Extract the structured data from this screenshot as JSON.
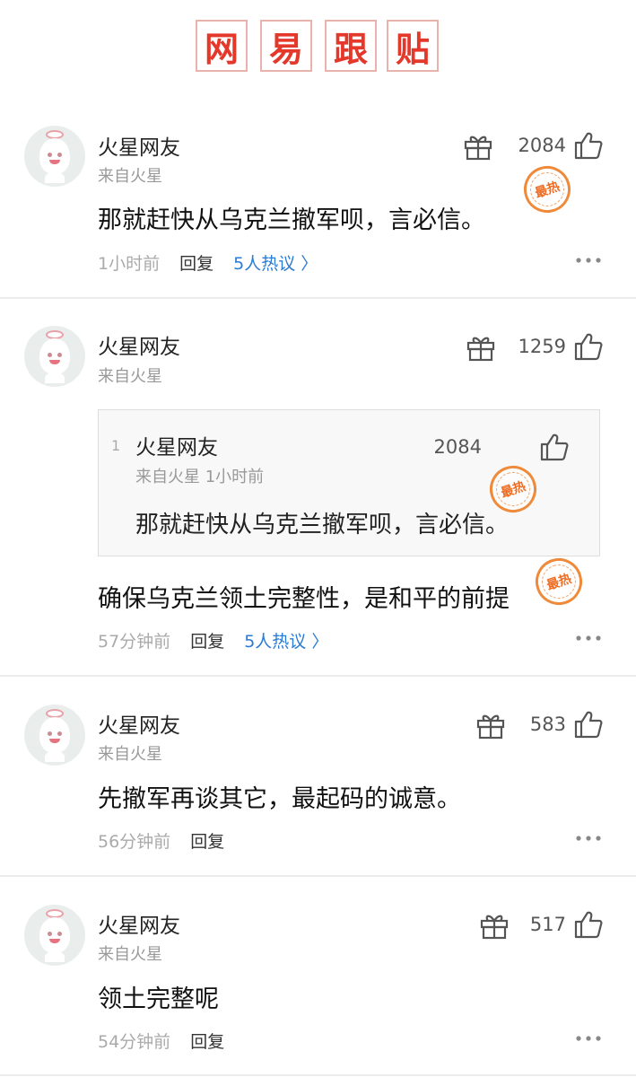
{
  "header": {
    "chars": [
      "网",
      "易",
      "跟",
      "贴"
    ]
  },
  "colors": {
    "brand_red": "#e4382b",
    "link_blue": "#2a7bd6",
    "hot_stamp": "#ee6d22"
  },
  "icons": {
    "gift": "gift-icon",
    "like": "thumb-up-icon",
    "more": "more-dots-icon",
    "avatar": "avatar-icon",
    "stamp": "hot-stamp-icon"
  },
  "comments": [
    {
      "username": "火星网友",
      "location": "来自火星",
      "likes": "2084",
      "stamp": "最热",
      "text": "那就赶快从乌克兰撤军呗，言必信。",
      "time": "1小时前",
      "reply": "回复",
      "hot_discussion": "5人热议 〉"
    },
    {
      "username": "火星网友",
      "location": "来自火星",
      "likes": "1259",
      "quote": {
        "index": "1",
        "username": "火星网友",
        "location_time": "来自火星  1小时前",
        "likes": "2084",
        "stamp": "最热",
        "text": "那就赶快从乌克兰撤军呗，言必信。"
      },
      "stamp": "最热",
      "text": "确保乌克兰领土完整性，是和平的前提",
      "time": "57分钟前",
      "reply": "回复",
      "hot_discussion": "5人热议 〉"
    },
    {
      "username": "火星网友",
      "location": "来自火星",
      "likes": "583",
      "text": "先撤军再谈其它，最起码的诚意。",
      "time": "56分钟前",
      "reply": "回复"
    },
    {
      "username": "火星网友",
      "location": "来自火星",
      "likes": "517",
      "text": "领土完整呢",
      "time": "54分钟前",
      "reply": "回复"
    }
  ]
}
